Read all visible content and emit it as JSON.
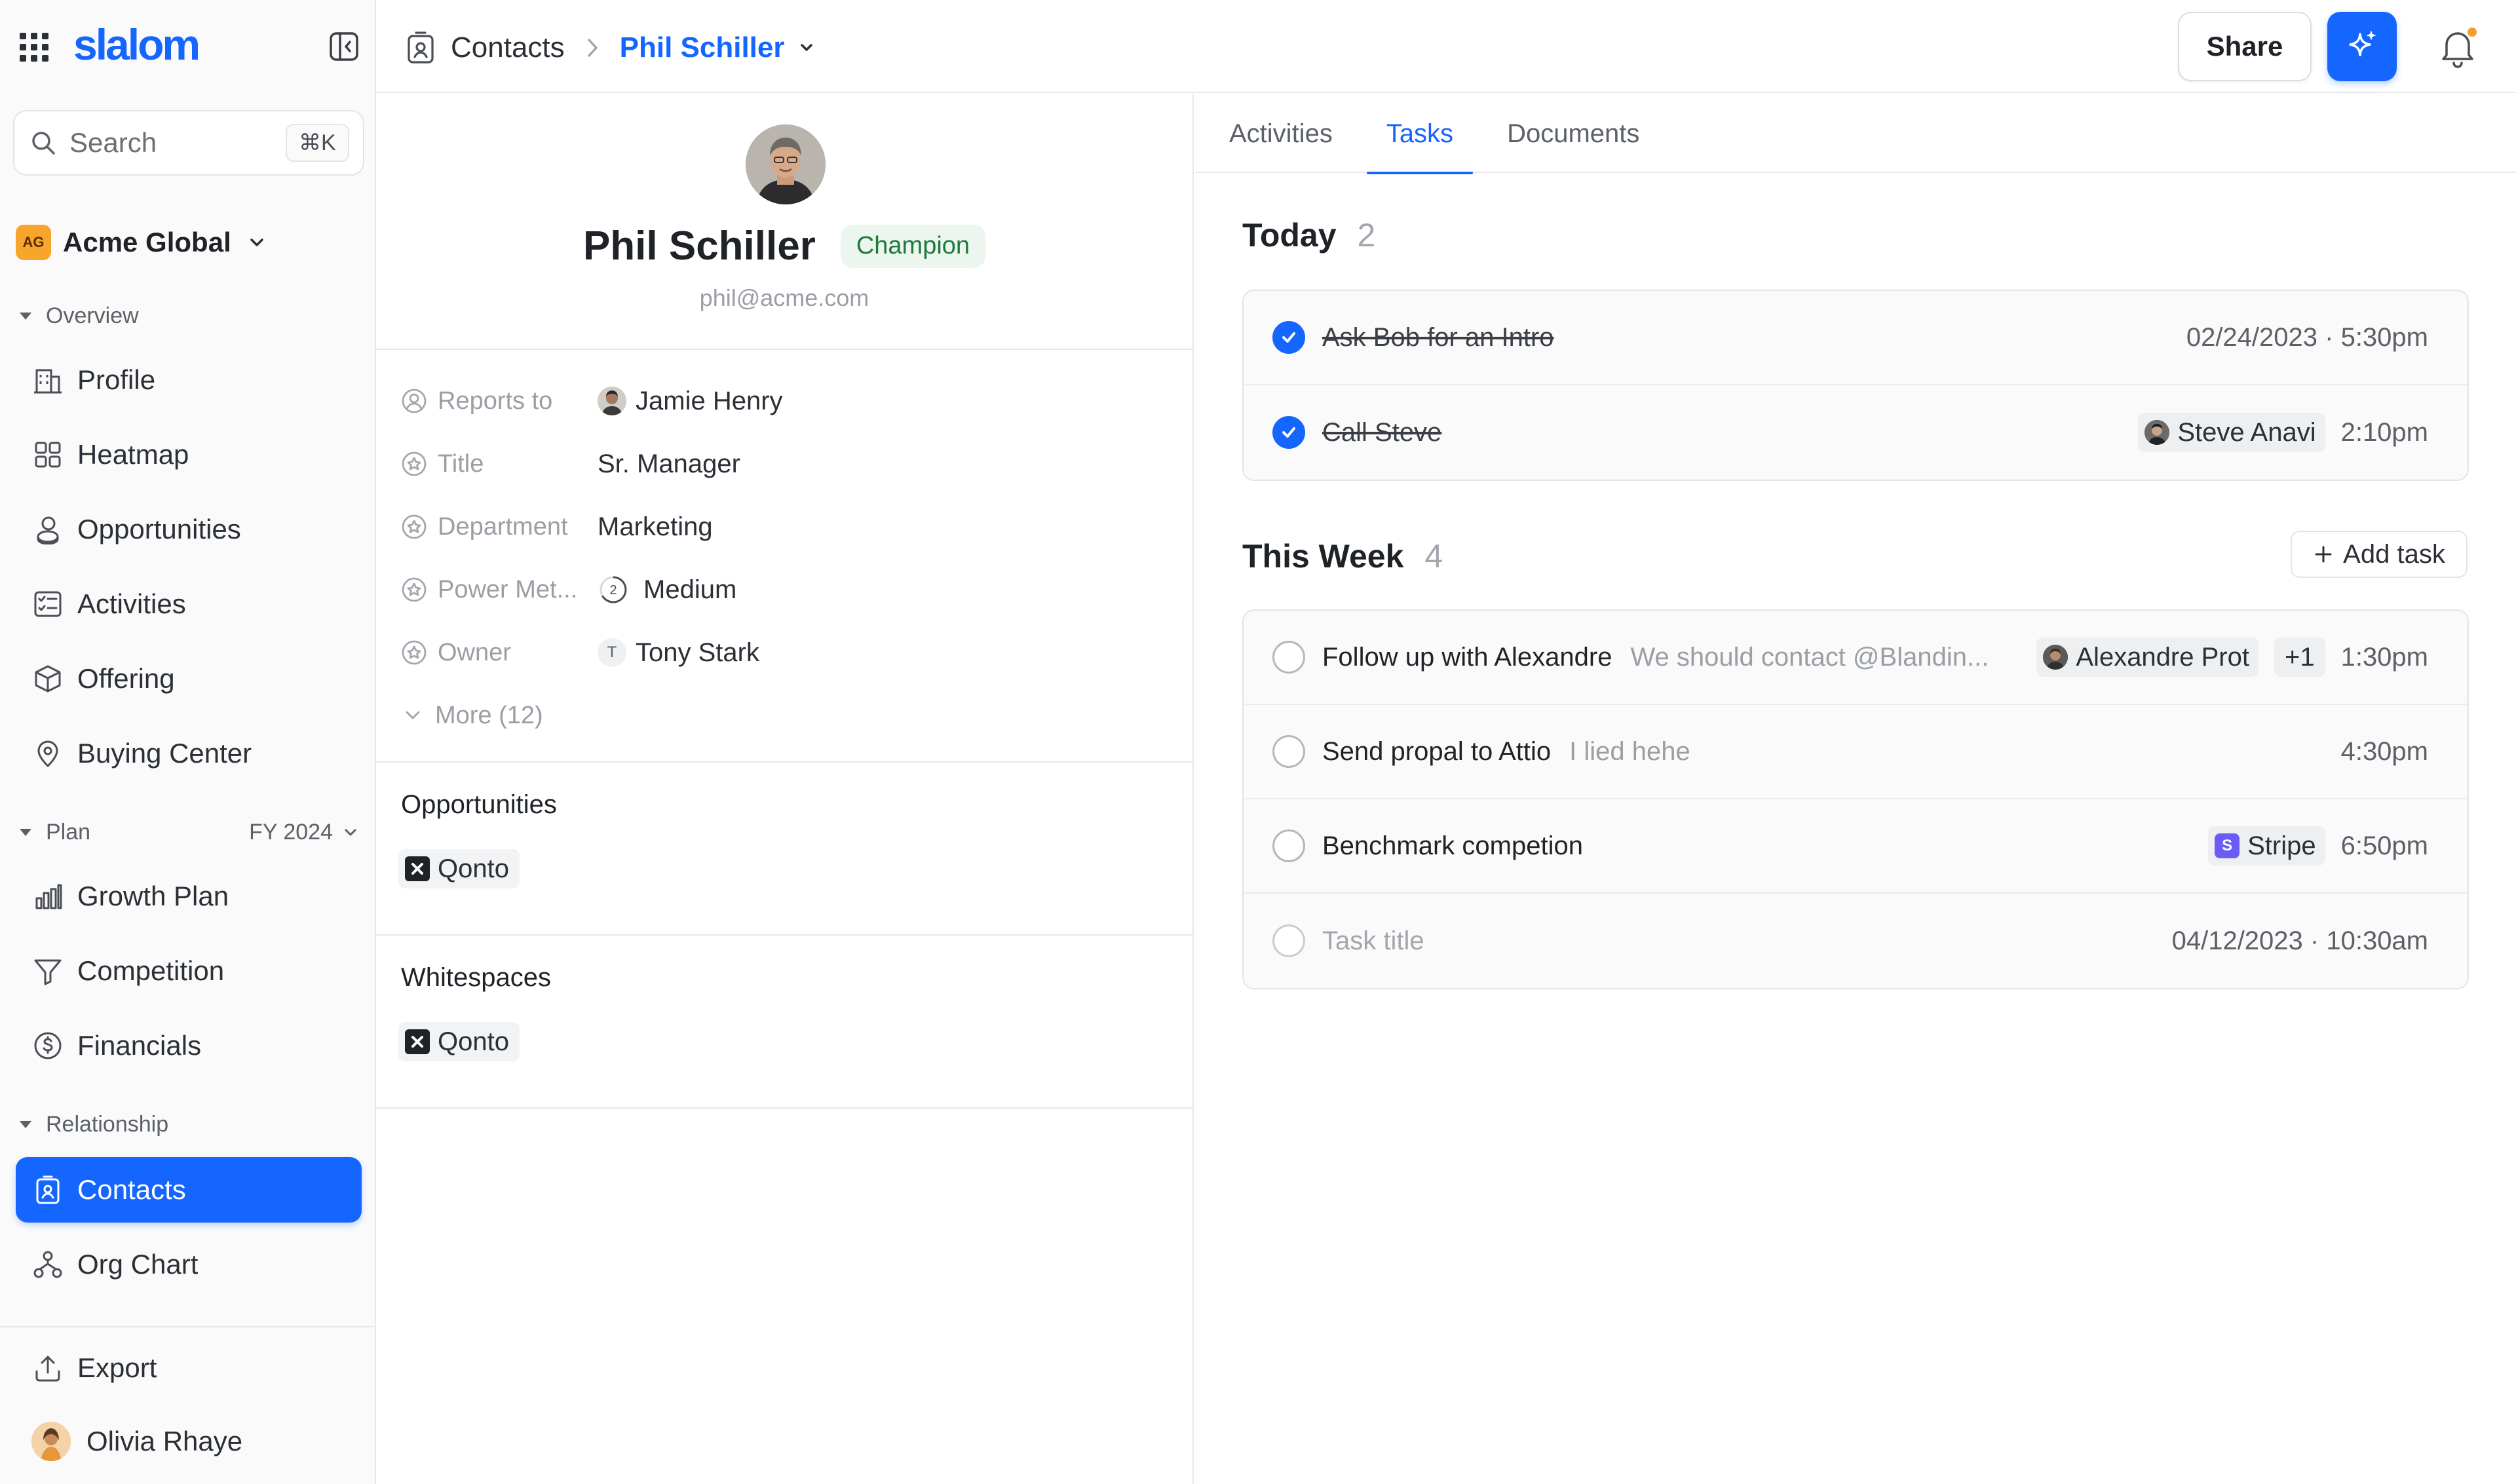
{
  "app": {
    "logo": "slalom",
    "accent": "#1565ff"
  },
  "search": {
    "placeholder": "Search",
    "shortcut": "⌘K"
  },
  "workspace": {
    "badge": "AG",
    "name": "Acme Global"
  },
  "sidebar": {
    "overview_label": "Overview",
    "overview_items": [
      {
        "label": "Profile",
        "icon": "building-icon"
      },
      {
        "label": "Heatmap",
        "icon": "grid-icon"
      },
      {
        "label": "Opportunities",
        "icon": "coins-icon"
      },
      {
        "label": "Activities",
        "icon": "checklist-icon"
      },
      {
        "label": "Offering",
        "icon": "box-icon"
      },
      {
        "label": "Buying Center",
        "icon": "map-pin-icon"
      }
    ],
    "plan_label": "Plan",
    "plan_period": "FY 2024",
    "plan_items": [
      {
        "label": "Growth Plan",
        "icon": "bar-chart-icon"
      },
      {
        "label": "Competition",
        "icon": "filter-icon"
      },
      {
        "label": "Financials",
        "icon": "dollar-icon"
      }
    ],
    "relationship_label": "Relationship",
    "relationship_items": [
      {
        "label": "Contacts",
        "icon": "contact-card-icon",
        "active": true
      },
      {
        "label": "Org Chart",
        "icon": "org-chart-icon"
      }
    ],
    "export_label": "Export",
    "user_name": "Olivia Rhaye"
  },
  "header": {
    "breadcrumb_root": "Contacts",
    "breadcrumb_current": "Phil Schiller",
    "share_label": "Share"
  },
  "contact": {
    "name": "Phil Schiller",
    "badge": "Champion",
    "email": "phil@acme.com",
    "attributes": [
      {
        "label": "Reports to",
        "value": "Jamie Henry"
      },
      {
        "label": "Title",
        "value": "Sr. Manager"
      },
      {
        "label": "Department",
        "value": "Marketing"
      },
      {
        "label": "Power Met...",
        "value": "Medium",
        "level": "2"
      },
      {
        "label": "Owner",
        "value": "Tony Stark",
        "initial": "T"
      }
    ],
    "more_label": "More (12)",
    "opportunities_title": "Opportunities",
    "opportunities_chip": "Qonto",
    "whitespaces_title": "Whitespaces",
    "whitespaces_chip": "Qonto"
  },
  "tabs": [
    "Activities",
    "Tasks",
    "Documents"
  ],
  "active_tab": "Tasks",
  "today": {
    "title": "Today",
    "count": "2",
    "tasks": [
      {
        "title": "Ask Bob for an Intro",
        "time": "02/24/2023 · 5:30pm",
        "done": true
      },
      {
        "title": "Call Steve",
        "assignee": "Steve Anavi",
        "time": "2:10pm",
        "done": true
      }
    ]
  },
  "this_week": {
    "title": "This Week",
    "count": "4",
    "add_label": "Add task",
    "tasks": [
      {
        "title": "Follow up with Alexandre",
        "desc": "We should contact @Blandin...",
        "assignee": "Alexandre Prot",
        "extra": "+1",
        "time": "1:30pm"
      },
      {
        "title": "Send propal to Attio",
        "desc": "I lied hehe",
        "time": "4:30pm"
      },
      {
        "title": "Benchmark competion",
        "company": "Stripe",
        "company_initial": "S",
        "time": "6:50pm"
      },
      {
        "title": "Task title",
        "time": "04/12/2023 · 10:30am",
        "placeholder": true
      }
    ]
  }
}
